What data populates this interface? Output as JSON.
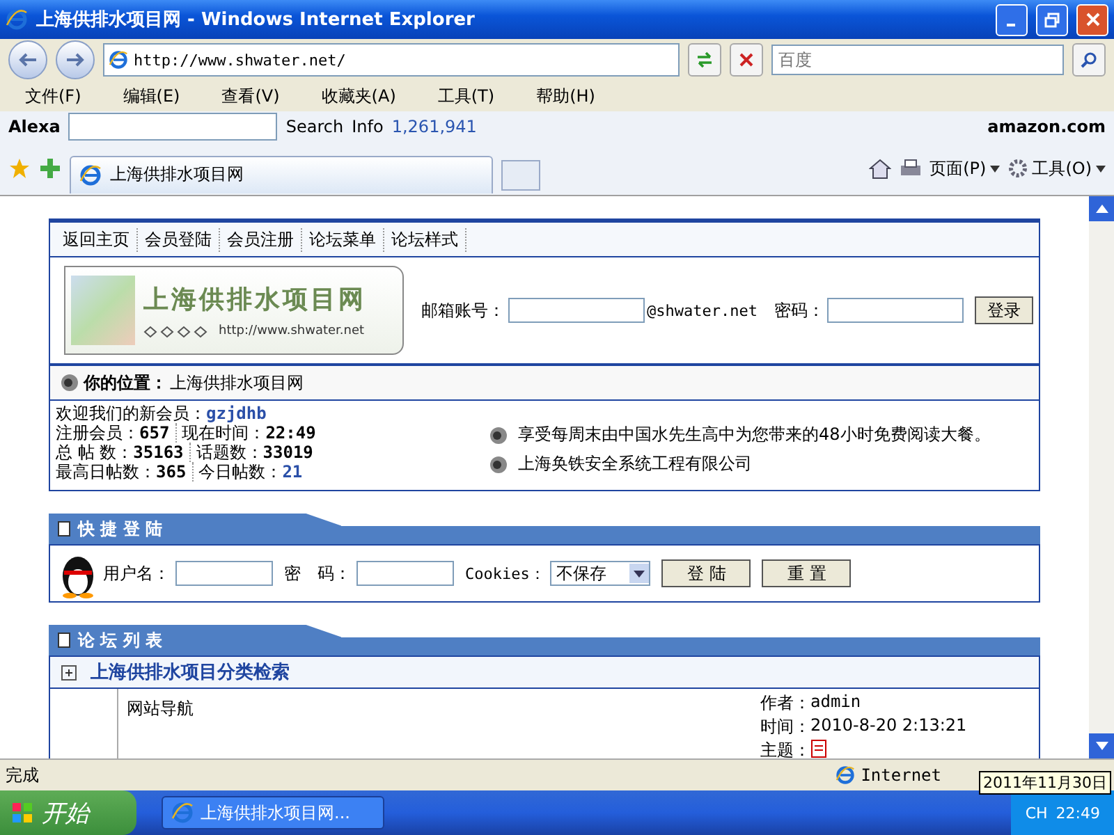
{
  "window": {
    "title": "上海供排水项目网 - Windows Internet Explorer"
  },
  "address_bar": {
    "url": "http://www.shwater.net/",
    "search_placeholder": "百度"
  },
  "menu": [
    "文件(F)",
    "编辑(E)",
    "查看(V)",
    "收藏夹(A)",
    "工具(T)",
    "帮助(H)"
  ],
  "alexa_toolbar": {
    "brand": "Alexa",
    "search": "Search",
    "info": "Info",
    "rank": "1,261,941",
    "shop": "amazon.com"
  },
  "tab_bar": {
    "tab": "上海供排水项目网",
    "page_menu": "页面(P)",
    "tools_menu": "工具(O)"
  },
  "page": {
    "nav": [
      "返回主页",
      "会员登陆",
      "会员注册",
      "论坛菜单",
      "论坛样式"
    ],
    "logo": {
      "title": "上海供排水项目网",
      "url": "http://www.shwater.net"
    },
    "mail_login": {
      "email_label": "邮箱账号：",
      "domain": "@shwater.net",
      "password_label": "密码：",
      "button": "登录"
    },
    "location": {
      "label": "你的位置：",
      "value": "上海供排水项目网"
    },
    "stats": [
      [
        {
          "label": "欢迎我们的新会员：",
          "value": "gzjdhb",
          "highlight": true
        }
      ],
      [
        {
          "label": "注册会员：",
          "value": "657",
          "highlight": false
        },
        {
          "label": "现在时间：",
          "value": "22:49",
          "highlight": false
        }
      ],
      [
        {
          "label": "总 帖 数：",
          "value": "35163",
          "highlight": false
        },
        {
          "label": "话题数：",
          "value": "33019",
          "highlight": false
        }
      ],
      [
        {
          "label": "最高日帖数：",
          "value": "365",
          "highlight": false
        },
        {
          "label": "今日帖数：",
          "value": "21",
          "highlight": true
        }
      ]
    ],
    "news": [
      "享受每周末由中国水先生高中为您带来的48小时免费阅读大餐。",
      "上海奂铁安全系统工程有限公司"
    ],
    "quick_login": {
      "title": "快 捷 登 陆",
      "username_label": "用户名：",
      "password_label": "密　码：",
      "cookies_label": "Cookies：",
      "cookies_value": "不保存",
      "buttons": [
        "登 陆",
        "重 置"
      ]
    },
    "forum_list": {
      "title": "论 坛 列 表",
      "category": {
        "title": "上海供排水项目分类检索",
        "expanded": false
      },
      "forums": [
        {
          "name": "网站导航",
          "author_label": "作者：",
          "author": "admin",
          "time_label": "时间：",
          "time": "2010-8-20 2:13:21",
          "topic_label": "主题："
        }
      ]
    }
  },
  "status_bar": {
    "text": "完成",
    "zone": "Internet"
  },
  "taskbar": {
    "start": "开始",
    "task": "上海供排水项目网...",
    "language": "CH",
    "clock": "22:49",
    "tooltip": "2011年11月30日"
  }
}
